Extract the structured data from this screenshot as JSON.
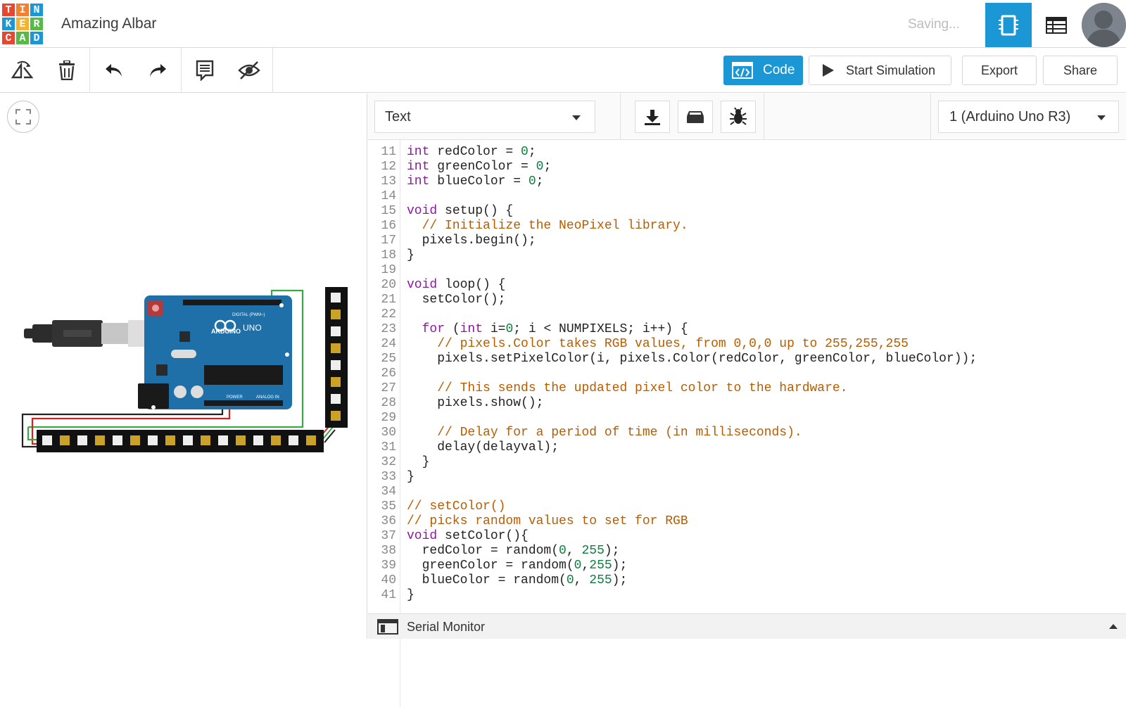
{
  "app": {
    "logo_letters": [
      "T",
      "I",
      "N",
      "K",
      "E",
      "R",
      "C",
      "A",
      "D"
    ],
    "logo_colors": [
      "#e8472f",
      "#f47f31",
      "#1c97d6",
      "#1c97d6",
      "#f4b32e",
      "#58b947",
      "#e8472f",
      "#58b947",
      "#1c97d6"
    ],
    "project_title": "Amazing Albar",
    "status": "Saving..."
  },
  "header": {
    "circuit_view_icon": "circuit-board-icon",
    "components_list_icon": "table-list-icon",
    "avatar_icon": "user-avatar"
  },
  "toolbar": {
    "tools": [
      "rotate-icon",
      "trash-icon",
      "undo-icon",
      "redo-icon",
      "notes-icon",
      "visibility-off-icon"
    ],
    "code_label": "Code",
    "start_simulation_label": "Start Simulation",
    "export_label": "Export",
    "share_label": "Share"
  },
  "code_panel": {
    "mode": "Text",
    "tools": [
      "download-icon",
      "library-icon",
      "debug-bug-icon"
    ],
    "board": "1 (Arduino Uno R3)",
    "lines": [
      {
        "n": "11",
        "segs": [
          [
            "kw",
            "int"
          ],
          [
            "",
            " redColor = "
          ],
          [
            "num",
            "0"
          ],
          [
            "",
            ";"
          ]
        ]
      },
      {
        "n": "12",
        "segs": [
          [
            "kw",
            "int"
          ],
          [
            "",
            " greenColor = "
          ],
          [
            "num",
            "0"
          ],
          [
            "",
            ";"
          ]
        ]
      },
      {
        "n": "13",
        "segs": [
          [
            "kw",
            "int"
          ],
          [
            "",
            " blueColor = "
          ],
          [
            "num",
            "0"
          ],
          [
            "",
            ";"
          ]
        ]
      },
      {
        "n": "14",
        "segs": []
      },
      {
        "n": "15",
        "segs": [
          [
            "kw",
            "void"
          ],
          [
            "",
            " setup() {"
          ]
        ]
      },
      {
        "n": "16",
        "segs": [
          [
            "cmt",
            "  // Initialize the NeoPixel library."
          ]
        ]
      },
      {
        "n": "17",
        "segs": [
          [
            "",
            "  pixels.begin();"
          ]
        ]
      },
      {
        "n": "18",
        "segs": [
          [
            "",
            "}"
          ]
        ]
      },
      {
        "n": "19",
        "segs": []
      },
      {
        "n": "20",
        "segs": [
          [
            "kw",
            "void"
          ],
          [
            "",
            " loop() {"
          ]
        ]
      },
      {
        "n": "21",
        "segs": [
          [
            "",
            "  setColor();"
          ]
        ]
      },
      {
        "n": "22",
        "segs": []
      },
      {
        "n": "23",
        "segs": [
          [
            "",
            "  "
          ],
          [
            "kw",
            "for"
          ],
          [
            "",
            " ("
          ],
          [
            "kw",
            "int"
          ],
          [
            "",
            " i="
          ],
          [
            "num",
            "0"
          ],
          [
            "",
            "; i < NUMPIXELS; i++) {"
          ]
        ]
      },
      {
        "n": "24",
        "segs": [
          [
            "cmt",
            "    // pixels.Color takes RGB values, from 0,0,0 up to 255,255,255"
          ]
        ]
      },
      {
        "n": "25",
        "segs": [
          [
            "",
            "    pixels.setPixelColor(i, pixels.Color(redColor, greenColor, blueColor));"
          ]
        ]
      },
      {
        "n": "26",
        "segs": []
      },
      {
        "n": "27",
        "segs": [
          [
            "cmt",
            "    // This sends the updated pixel color to the hardware."
          ]
        ]
      },
      {
        "n": "28",
        "segs": [
          [
            "",
            "    pixels.show();"
          ]
        ]
      },
      {
        "n": "29",
        "segs": []
      },
      {
        "n": "30",
        "segs": [
          [
            "cmt",
            "    // Delay for a period of time (in milliseconds)."
          ]
        ]
      },
      {
        "n": "31",
        "segs": [
          [
            "",
            "    delay(delayval);"
          ]
        ]
      },
      {
        "n": "32",
        "segs": [
          [
            "",
            "  }"
          ]
        ]
      },
      {
        "n": "33",
        "segs": [
          [
            "",
            "}"
          ]
        ]
      },
      {
        "n": "34",
        "segs": []
      },
      {
        "n": "35",
        "segs": [
          [
            "cmt",
            "// setColor()"
          ]
        ]
      },
      {
        "n": "36",
        "segs": [
          [
            "cmt",
            "// picks random values to set for RGB"
          ]
        ]
      },
      {
        "n": "37",
        "segs": [
          [
            "kw",
            "void"
          ],
          [
            "",
            " setColor(){"
          ]
        ]
      },
      {
        "n": "38",
        "segs": [
          [
            "",
            "  redColor = random("
          ],
          [
            "num",
            "0"
          ],
          [
            "",
            ", "
          ],
          [
            "num",
            "255"
          ],
          [
            "",
            ");"
          ]
        ]
      },
      {
        "n": "39",
        "segs": [
          [
            "",
            "  greenColor = random("
          ],
          [
            "num",
            "0"
          ],
          [
            "",
            ","
          ],
          [
            "num",
            "255"
          ],
          [
            "",
            ");"
          ]
        ]
      },
      {
        "n": "40",
        "segs": [
          [
            "",
            "  blueColor = random("
          ],
          [
            "num",
            "0"
          ],
          [
            "",
            ", "
          ],
          [
            "num",
            "255"
          ],
          [
            "",
            ");"
          ]
        ]
      },
      {
        "n": "41",
        "segs": [
          [
            "",
            "}"
          ]
        ]
      }
    ]
  },
  "board_labels": {
    "brand": "ARDUINO",
    "model": "UNO",
    "digital": "DIGITAL (PWM~)",
    "power": "POWER",
    "analog": "ANALOG IN"
  },
  "serial_monitor": {
    "label": "Serial Monitor"
  },
  "colors": {
    "accent": "#1c97d6",
    "board": "#1f6fa8",
    "keyword": "#8a1a9c",
    "number": "#0f7d3e",
    "comment": "#b85c00"
  }
}
